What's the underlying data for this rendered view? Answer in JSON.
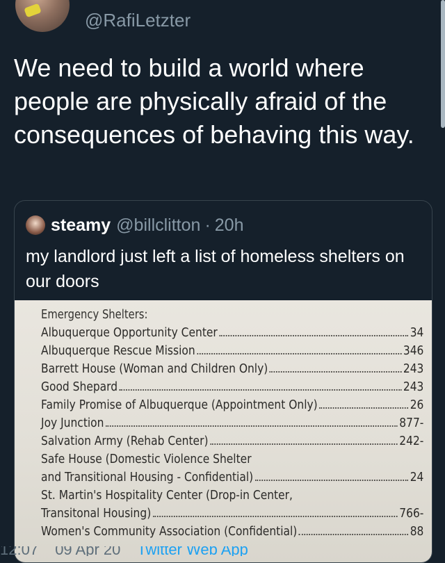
{
  "tweet": {
    "handle": "@RafiLetzter",
    "text": "We need to build a world where people are physically afraid of the consequences of behaving this way."
  },
  "quote": {
    "name": "steamy",
    "handle": "@billclitton",
    "separator": "·",
    "time": "20h",
    "text": "my landlord just left a list of homeless shelters on our doors"
  },
  "document": {
    "heading": "Emergency Shelters:",
    "entries": [
      {
        "name": "Albuquerque Opportunity Center",
        "number": "34"
      },
      {
        "name": "Albuquerque Rescue Mission",
        "number": "346"
      },
      {
        "name": "Barrett House (Woman and Children Only)",
        "number": "243"
      },
      {
        "name": "Good Shepard",
        "number": "243"
      },
      {
        "name": "Family Promise of Albuquerque (Appointment Only)",
        "number": "26"
      },
      {
        "name": "Joy Junction",
        "number": "877-"
      },
      {
        "name": "Salvation Army (Rehab Center)",
        "number": "242-"
      },
      {
        "name": "Safe House (Domestic Violence Shelter",
        "number": ""
      },
      {
        "name": "and Transitional Housing - Confidential)",
        "number": "24"
      },
      {
        "name": "St. Martin's Hospitality Center (Drop-in Center,",
        "number": ""
      },
      {
        "name": "Transitonal Housing)",
        "number": "766-"
      },
      {
        "name": "Women's Community Association (Confidential)",
        "number": "88"
      }
    ]
  },
  "footer": {
    "time": "12:07",
    "date": "09 Apr 20",
    "source": "Twitter Web App"
  }
}
